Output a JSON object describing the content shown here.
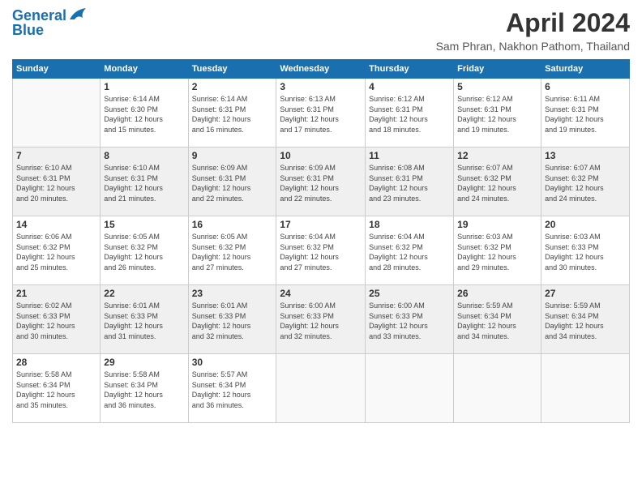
{
  "header": {
    "logo_line1": "General",
    "logo_line2": "Blue",
    "title": "April 2024",
    "location": "Sam Phran, Nakhon Pathom, Thailand"
  },
  "columns": [
    "Sunday",
    "Monday",
    "Tuesday",
    "Wednesday",
    "Thursday",
    "Friday",
    "Saturday"
  ],
  "weeks": [
    [
      {
        "day": "",
        "info": ""
      },
      {
        "day": "1",
        "info": "Sunrise: 6:14 AM\nSunset: 6:30 PM\nDaylight: 12 hours\nand 15 minutes."
      },
      {
        "day": "2",
        "info": "Sunrise: 6:14 AM\nSunset: 6:31 PM\nDaylight: 12 hours\nand 16 minutes."
      },
      {
        "day": "3",
        "info": "Sunrise: 6:13 AM\nSunset: 6:31 PM\nDaylight: 12 hours\nand 17 minutes."
      },
      {
        "day": "4",
        "info": "Sunrise: 6:12 AM\nSunset: 6:31 PM\nDaylight: 12 hours\nand 18 minutes."
      },
      {
        "day": "5",
        "info": "Sunrise: 6:12 AM\nSunset: 6:31 PM\nDaylight: 12 hours\nand 19 minutes."
      },
      {
        "day": "6",
        "info": "Sunrise: 6:11 AM\nSunset: 6:31 PM\nDaylight: 12 hours\nand 19 minutes."
      }
    ],
    [
      {
        "day": "7",
        "info": "Sunrise: 6:10 AM\nSunset: 6:31 PM\nDaylight: 12 hours\nand 20 minutes."
      },
      {
        "day": "8",
        "info": "Sunrise: 6:10 AM\nSunset: 6:31 PM\nDaylight: 12 hours\nand 21 minutes."
      },
      {
        "day": "9",
        "info": "Sunrise: 6:09 AM\nSunset: 6:31 PM\nDaylight: 12 hours\nand 22 minutes."
      },
      {
        "day": "10",
        "info": "Sunrise: 6:09 AM\nSunset: 6:31 PM\nDaylight: 12 hours\nand 22 minutes."
      },
      {
        "day": "11",
        "info": "Sunrise: 6:08 AM\nSunset: 6:31 PM\nDaylight: 12 hours\nand 23 minutes."
      },
      {
        "day": "12",
        "info": "Sunrise: 6:07 AM\nSunset: 6:32 PM\nDaylight: 12 hours\nand 24 minutes."
      },
      {
        "day": "13",
        "info": "Sunrise: 6:07 AM\nSunset: 6:32 PM\nDaylight: 12 hours\nand 24 minutes."
      }
    ],
    [
      {
        "day": "14",
        "info": "Sunrise: 6:06 AM\nSunset: 6:32 PM\nDaylight: 12 hours\nand 25 minutes."
      },
      {
        "day": "15",
        "info": "Sunrise: 6:05 AM\nSunset: 6:32 PM\nDaylight: 12 hours\nand 26 minutes."
      },
      {
        "day": "16",
        "info": "Sunrise: 6:05 AM\nSunset: 6:32 PM\nDaylight: 12 hours\nand 27 minutes."
      },
      {
        "day": "17",
        "info": "Sunrise: 6:04 AM\nSunset: 6:32 PM\nDaylight: 12 hours\nand 27 minutes."
      },
      {
        "day": "18",
        "info": "Sunrise: 6:04 AM\nSunset: 6:32 PM\nDaylight: 12 hours\nand 28 minutes."
      },
      {
        "day": "19",
        "info": "Sunrise: 6:03 AM\nSunset: 6:32 PM\nDaylight: 12 hours\nand 29 minutes."
      },
      {
        "day": "20",
        "info": "Sunrise: 6:03 AM\nSunset: 6:33 PM\nDaylight: 12 hours\nand 30 minutes."
      }
    ],
    [
      {
        "day": "21",
        "info": "Sunrise: 6:02 AM\nSunset: 6:33 PM\nDaylight: 12 hours\nand 30 minutes."
      },
      {
        "day": "22",
        "info": "Sunrise: 6:01 AM\nSunset: 6:33 PM\nDaylight: 12 hours\nand 31 minutes."
      },
      {
        "day": "23",
        "info": "Sunrise: 6:01 AM\nSunset: 6:33 PM\nDaylight: 12 hours\nand 32 minutes."
      },
      {
        "day": "24",
        "info": "Sunrise: 6:00 AM\nSunset: 6:33 PM\nDaylight: 12 hours\nand 32 minutes."
      },
      {
        "day": "25",
        "info": "Sunrise: 6:00 AM\nSunset: 6:33 PM\nDaylight: 12 hours\nand 33 minutes."
      },
      {
        "day": "26",
        "info": "Sunrise: 5:59 AM\nSunset: 6:34 PM\nDaylight: 12 hours\nand 34 minutes."
      },
      {
        "day": "27",
        "info": "Sunrise: 5:59 AM\nSunset: 6:34 PM\nDaylight: 12 hours\nand 34 minutes."
      }
    ],
    [
      {
        "day": "28",
        "info": "Sunrise: 5:58 AM\nSunset: 6:34 PM\nDaylight: 12 hours\nand 35 minutes."
      },
      {
        "day": "29",
        "info": "Sunrise: 5:58 AM\nSunset: 6:34 PM\nDaylight: 12 hours\nand 36 minutes."
      },
      {
        "day": "30",
        "info": "Sunrise: 5:57 AM\nSunset: 6:34 PM\nDaylight: 12 hours\nand 36 minutes."
      },
      {
        "day": "",
        "info": ""
      },
      {
        "day": "",
        "info": ""
      },
      {
        "day": "",
        "info": ""
      },
      {
        "day": "",
        "info": ""
      }
    ]
  ]
}
